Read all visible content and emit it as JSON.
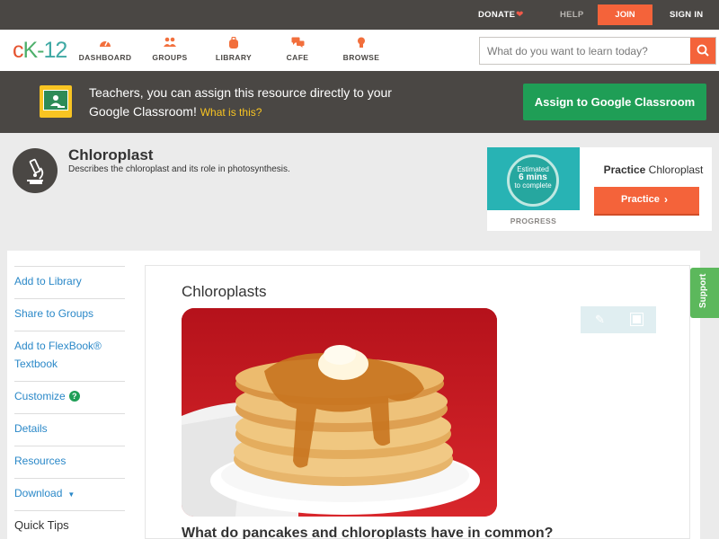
{
  "topbar": {
    "donate": "DONATE",
    "help": "HELP",
    "join": "JOIN",
    "signin": "SIGN IN"
  },
  "nav": {
    "logo": {
      "c": "c",
      "k": "K-",
      "n": "12"
    },
    "items": [
      {
        "label": "DASHBOARD",
        "icon": "dashboard-gauge-icon"
      },
      {
        "label": "GROUPS",
        "icon": "groups-people-icon"
      },
      {
        "label": "LIBRARY",
        "icon": "library-backpack-icon"
      },
      {
        "label": "CAFE",
        "icon": "cafe-chat-icon"
      },
      {
        "label": "BROWSE",
        "icon": "browse-lightbulb-icon"
      }
    ],
    "search_placeholder": "What do you want to learn today?"
  },
  "classroom_banner": {
    "text": "Teachers, you can assign this resource directly to your Google Classroom!",
    "what_link": "What is this?",
    "assign_button": "Assign to Google Classroom"
  },
  "concept": {
    "title": "Chloroplast",
    "description": "Describes the chloroplast and its role in photosynthesis."
  },
  "progress_card": {
    "estimated": "Estimated",
    "mins": "6 mins",
    "to_complete": "to complete",
    "progress_label": "PROGRESS",
    "practice_prefix": "Practice",
    "practice_topic": "Chloroplast",
    "practice_button": "Practice"
  },
  "sidebar": {
    "items": [
      "Add to Library",
      "Share to Groups",
      "Add to FlexBook®",
      "Textbook",
      "Customize",
      "Details",
      "Resources",
      "Download"
    ],
    "quick_tips": "Quick Tips"
  },
  "reading": {
    "title": "Chloroplasts",
    "question": "What do pancakes and chloroplasts have in common?"
  },
  "support": "Support",
  "colors": {
    "accent_orange": "#f4633a",
    "google_green": "#1f9e56",
    "link_blue": "#2a88c8",
    "dark_bar": "#4a4744",
    "support_green": "#5cb85c"
  }
}
